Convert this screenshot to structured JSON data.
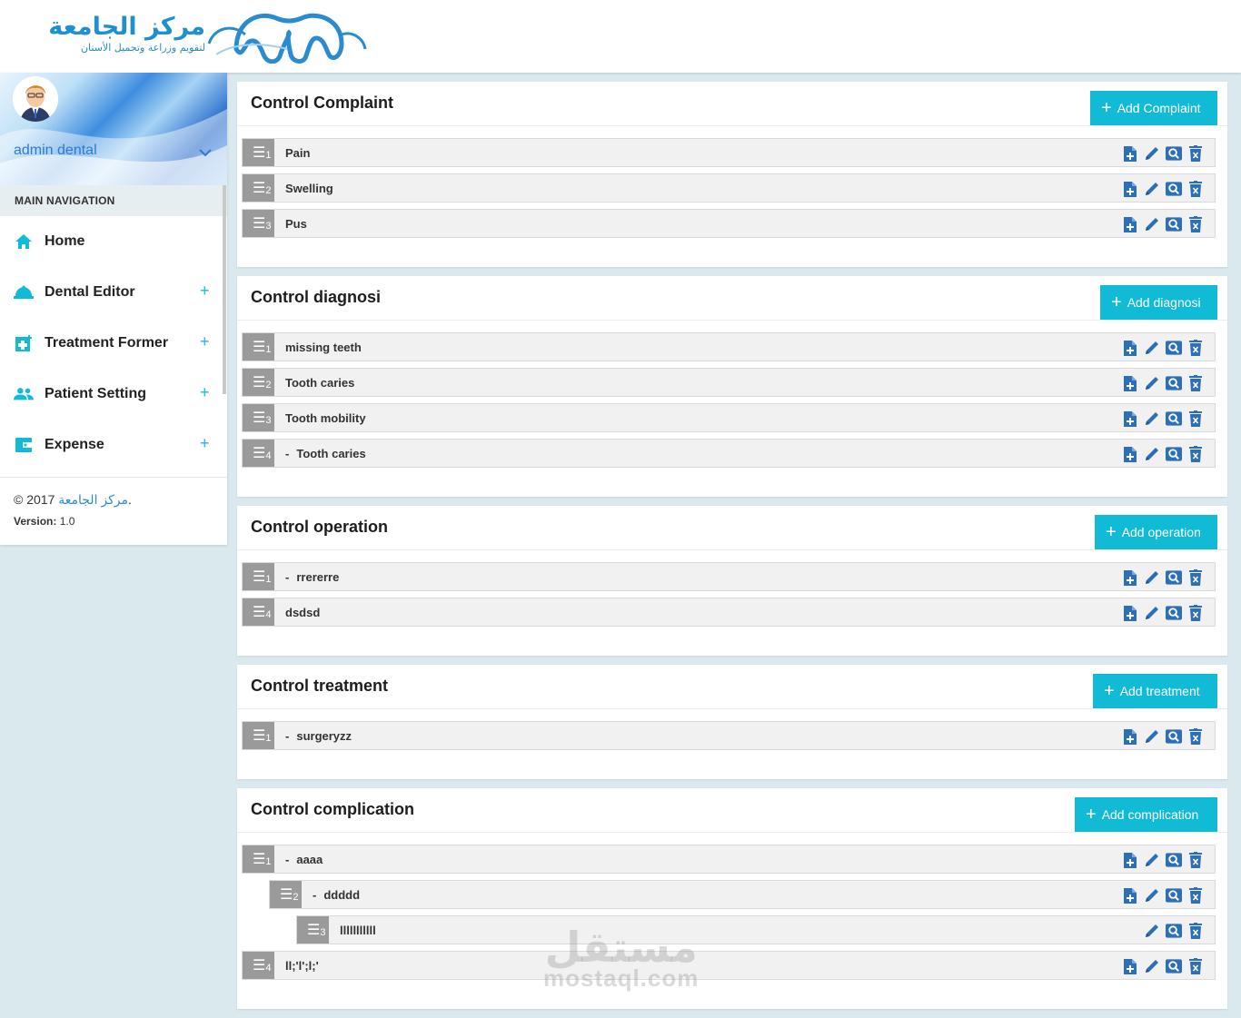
{
  "brand": {
    "name_ar": "مركز الجامعة",
    "tagline_ar": "لتقويم وزراعة وتجميل الأسنان",
    "logo_icon": "tooth-logo-icon",
    "accent": "#12bbd5"
  },
  "sidebar": {
    "user_name": "admin dental",
    "nav_header": "MAIN NAVIGATION",
    "items": [
      {
        "label": "Home",
        "icon": "home-icon",
        "expand": ""
      },
      {
        "label": "Dental Editor",
        "icon": "dental-chair-icon",
        "expand": "+"
      },
      {
        "label": "Treatment Former",
        "icon": "medical-calendar-icon",
        "expand": "+"
      },
      {
        "label": "Patient Setting",
        "icon": "users-icon",
        "expand": "+"
      },
      {
        "label": "Expense",
        "icon": "wallet-icon",
        "expand": "+"
      }
    ],
    "copyright_prefix": "© 2017",
    "copyright_brand": "مركز الجامعة",
    "copyright_suffix": ".",
    "version_label": "Version:",
    "version_value": "1.0"
  },
  "panels": [
    {
      "title": "Control Complaint",
      "add_label": "Add Complaint",
      "rows": [
        {
          "num": "1",
          "label": "Pain",
          "dash": false
        },
        {
          "num": "2",
          "label": "Swelling",
          "dash": false
        },
        {
          "num": "3",
          "label": "Pus",
          "dash": false
        }
      ]
    },
    {
      "title": "Control diagnosi",
      "add_label": "Add diagnosi",
      "rows": [
        {
          "num": "1",
          "label": "missing teeth",
          "dash": false
        },
        {
          "num": "2",
          "label": "Tooth caries",
          "dash": false
        },
        {
          "num": "3",
          "label": "Tooth mobility",
          "dash": false
        },
        {
          "num": "4",
          "label": "Tooth caries",
          "dash": true
        }
      ]
    },
    {
      "title": "Control operation",
      "add_label": "Add operation",
      "rows": [
        {
          "num": "1",
          "label": "rrererre",
          "dash": true
        },
        {
          "num": "4",
          "label": "dsdsd",
          "dash": false
        }
      ]
    },
    {
      "title": "Control treatment",
      "add_label": "Add treatment",
      "rows": [
        {
          "num": "1",
          "label": "surgeryzz",
          "dash": true
        }
      ]
    },
    {
      "title": "Control complication",
      "add_label": "Add complication",
      "rows": [
        {
          "num": "1",
          "label": "aaaa",
          "dash": true
        },
        {
          "num": "2",
          "label": "ddddd",
          "dash": true
        },
        {
          "num": "3",
          "label": "lllllllllll",
          "dash": false
        },
        {
          "num": "4",
          "label": "ll;'l';l;'",
          "dash": false
        }
      ]
    }
  ],
  "row_icons": [
    "add-file-icon",
    "edit-pencil-icon",
    "search-icon",
    "delete-icon"
  ],
  "handle_glyph": "☰",
  "watermark": {
    "ar": "مستقل",
    "en": "mostaql.com"
  }
}
